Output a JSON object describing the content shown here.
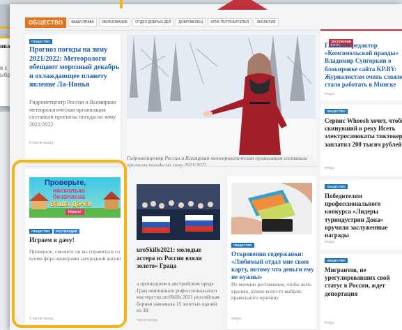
{
  "background_page": {
    "title_fragment": "ива",
    "line1_fragment": "в с",
    "line2_fragment": "ыбр"
  },
  "nav": {
    "section": "ОБЩЕСТВО",
    "items": [
      "Ваши права",
      "Образование",
      "Отдел добрых дел",
      "Доброволец",
      "Клуб потребителей",
      "Экология"
    ]
  },
  "main_article": {
    "tag": "ОБЩЕСТВО",
    "headline": "Прогноз погоды на зиму 2021/2022: Метеорологи обещают морозный декабрь и охлаждающее планету явление Ла-Нинья",
    "body": "Гидрометцентр России и Всемирная метеорологическая организация составили прогнозы погоды на зиму 2021/2022",
    "time": "8 часов назад"
  },
  "hero": {
    "caption": "Гидрометцентр России и Всемирная метеорологическая организация составили прогнозы погоды на зиму 2021/2022"
  },
  "right_column": [
    {
      "tags": [
        "ОБЩЕСТВО",
        "ЭКСКЛЮЗИВ КП.RU"
      ],
      "headline": "Главный редактор «Комсомольской правды» Владимир Сунгоркин о блокировке сайта KP.BY: Журналистам очень сложно стало работать в Минске",
      "time": "вчера"
    },
    {
      "tags": [
        "ОБЩЕСТВО"
      ],
      "headline": "Сервис Whoosh хочет, чтобы скинувший в реку Исеть электросамокаты тиктокер заплатил 200 тысяч рублей",
      "time": "вчера"
    },
    {
      "tags": [
        "ОБЩЕСТВО"
      ],
      "headline": "Победителям профессионального конкурса «Лидеры туриндустрии Дона» вручили заслуженные награды",
      "time": "вчера"
    },
    {
      "tags": [
        "ОБЩЕСТВО"
      ],
      "headline": "Мигрантов, не урегулировавших свой статус в России, ждет депортация",
      "time": "вчера"
    }
  ],
  "game_card": {
    "banner_line1": "Проверьте,",
    "banner_line2": "насколько",
    "banner_line3": "безопасна",
    "banner_line4": "ваша дача!",
    "banner_button": "Играть!",
    "tags": [
      "ОБЩЕСТВО",
      "РОСГВАРДИЯ"
    ],
    "headline": "Играем в дачу!",
    "body": "Проверьте, сможете ли вы справиться со всеми форс-мажорами загородной жизни",
    "time": "9 часов назад"
  },
  "ws_card": {
    "headline": "uroSkills2021: молодые астера из России взяли золото» Граца",
    "body": "а прошедшем в австрийском ороде Грац чемпионате рофессионального мастерства uroSkills 2021 российская борная завоевала 15 золотых едалей из 38.",
    "time": "часов назад"
  },
  "confession_card": {
    "tag": "ОБЩЕСТВО",
    "headline": "Откровения содержанки: «Любимый отдал мне свою карту, потому что деньги ему не нужны»",
    "body": "По моемню ростовчанок, чтобы жить красиво, нужно всего-то выбрать правильного мужчину",
    "time": "вчера"
  },
  "colors": {
    "accent_orange": "#e8711c",
    "accent_red": "#c0313e",
    "link_blue": "#1a5fae",
    "highlight_yellow": "#f7b314"
  }
}
